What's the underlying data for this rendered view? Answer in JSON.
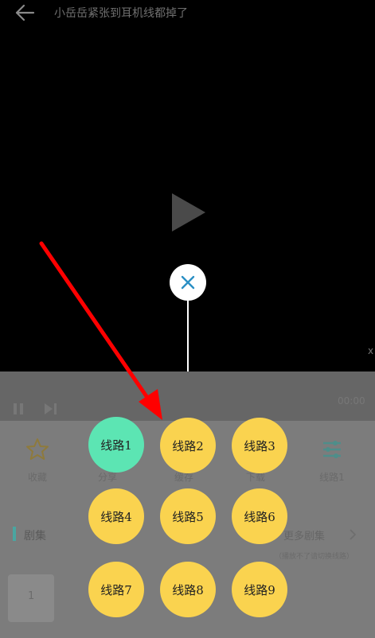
{
  "header": {
    "title": "小岳岳紧张到耳机线都掉了",
    "back_icon": "arrow-left-icon"
  },
  "player": {
    "play_icon": "play-icon",
    "close_icon": "close-icon",
    "side_mark": "x"
  },
  "controls": {
    "time_right": "00:00"
  },
  "actions": [
    {
      "label": "收藏",
      "icon": "star-icon"
    },
    {
      "label": "分享",
      "icon": "share-icon"
    },
    {
      "label": "缓存",
      "icon": "download-icon"
    },
    {
      "label": "下载",
      "icon": "folder-icon"
    },
    {
      "label": "线路1",
      "icon": "sliders-icon"
    }
  ],
  "episodes": {
    "title": "剧集",
    "more": "更多剧集",
    "hint": "（播放不了请切换线路）",
    "first": "1"
  },
  "routes": [
    {
      "label": "线路1",
      "active": true
    },
    {
      "label": "线路2",
      "active": false
    },
    {
      "label": "线路3",
      "active": false
    },
    {
      "label": "线路4",
      "active": false
    },
    {
      "label": "线路5",
      "active": false
    },
    {
      "label": "线路6",
      "active": false
    },
    {
      "label": "线路7",
      "active": false
    },
    {
      "label": "线路8",
      "active": false
    },
    {
      "label": "线路9",
      "active": false
    }
  ],
  "colors": {
    "active_route": "#5ce5b3",
    "route": "#fad34f",
    "arrow": "#ff0000",
    "accent": "#4aa6a1"
  }
}
